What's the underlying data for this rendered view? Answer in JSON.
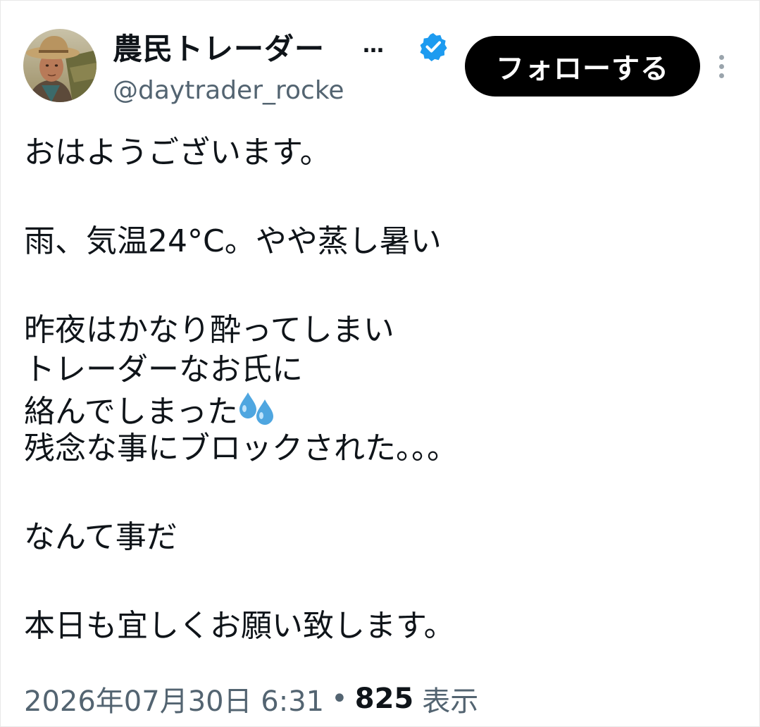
{
  "tweet": {
    "author": {
      "display_name": "農民トレーダー",
      "name_ellipsis": "…",
      "handle": "@daytrader_rocke",
      "verified_icon": "verified-badge-icon",
      "verified_color": "#1d9bf0",
      "avatar": "farmer-portrait"
    },
    "follow_label": "フォローする",
    "more_icon": "more-vertical-icon",
    "lines": [
      "おはようございます。",
      "",
      "雨、気温24°C。やや蒸し暑い",
      "",
      "昨夜はかなり酔ってしまい",
      "トレーダーなお氏に",
      "絡んでしまった",
      "残念な事にブロックされた。。。",
      "",
      "なんて事だ",
      "",
      "本日も宜しくお願い致します。"
    ],
    "emoji_after_line_7": "sweat-droplets-emoji",
    "timestamp": "2026年07月30日 6:31",
    "separator": "•",
    "views_count": "825",
    "views_label": "表示"
  }
}
